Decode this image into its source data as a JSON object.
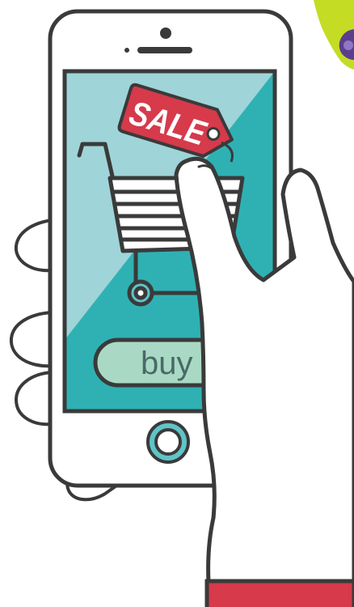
{
  "tag": {
    "label": "SALE"
  },
  "button": {
    "label": "buy"
  },
  "colors": {
    "outline": "#3a3a3a",
    "screen_light": "#9fd4d8",
    "screen_dark": "#2fb1b4",
    "tag_red": "#d63a4b",
    "button_fill": "#a9d9c4",
    "home_ring": "#5fc4c8",
    "sleeve": "#d63a4b",
    "toy_green": "#c4dc24",
    "toy_purple": "#5b3f8c"
  },
  "icons": [
    "shopping-cart-icon",
    "sale-tag-icon",
    "home-button-icon",
    "speaker-icon",
    "camera-icon"
  ]
}
